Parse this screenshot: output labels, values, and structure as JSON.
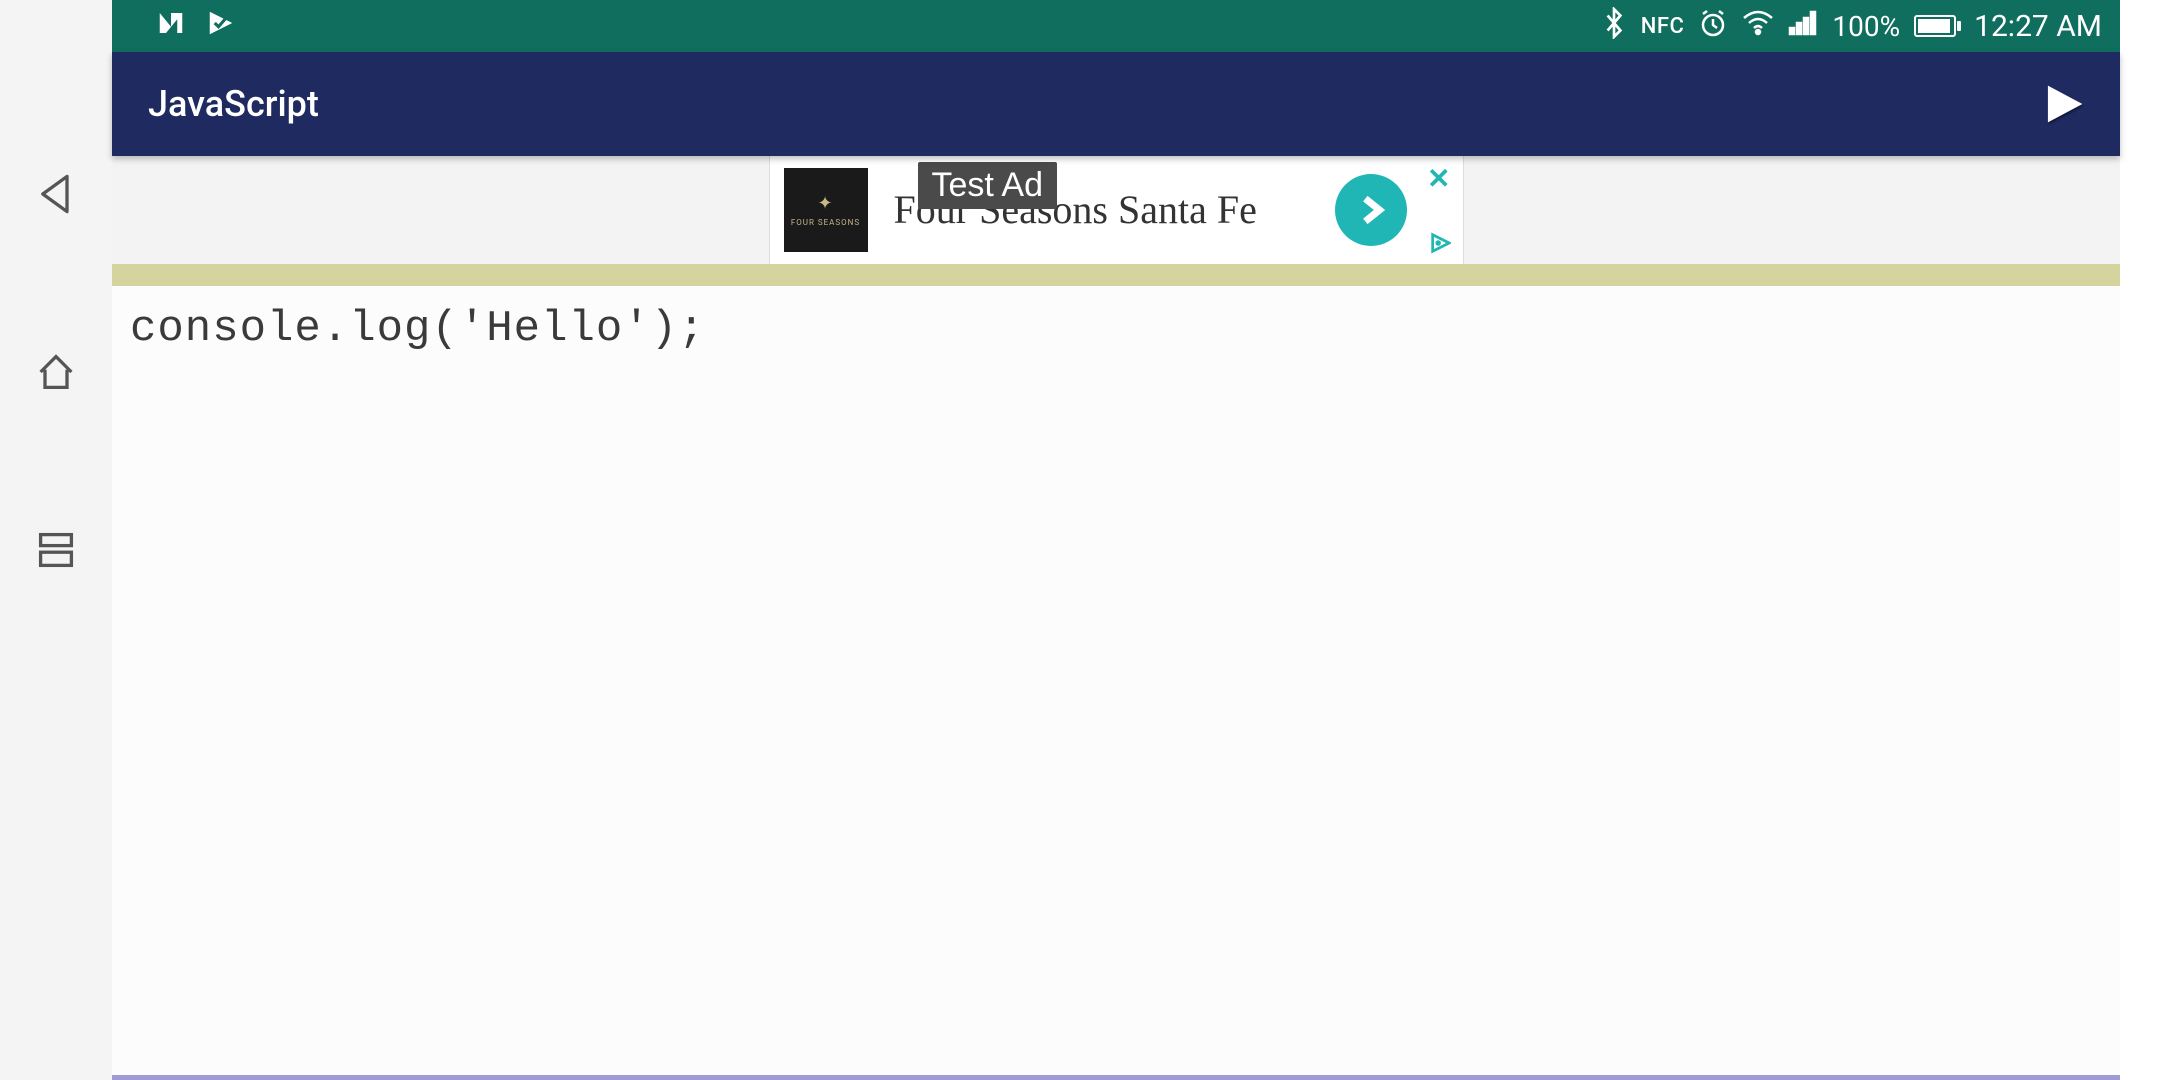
{
  "statusbar": {
    "nfc_label": "NFC",
    "battery_pct": "100%",
    "time": "12:27 AM"
  },
  "appbar": {
    "title": "JavaScript"
  },
  "ad": {
    "brand_small": "FOUR SEASONS",
    "headline": "Four Seasons Santa Fe",
    "overlay": "Test Ad"
  },
  "editor": {
    "code": "console.log('Hello');"
  }
}
